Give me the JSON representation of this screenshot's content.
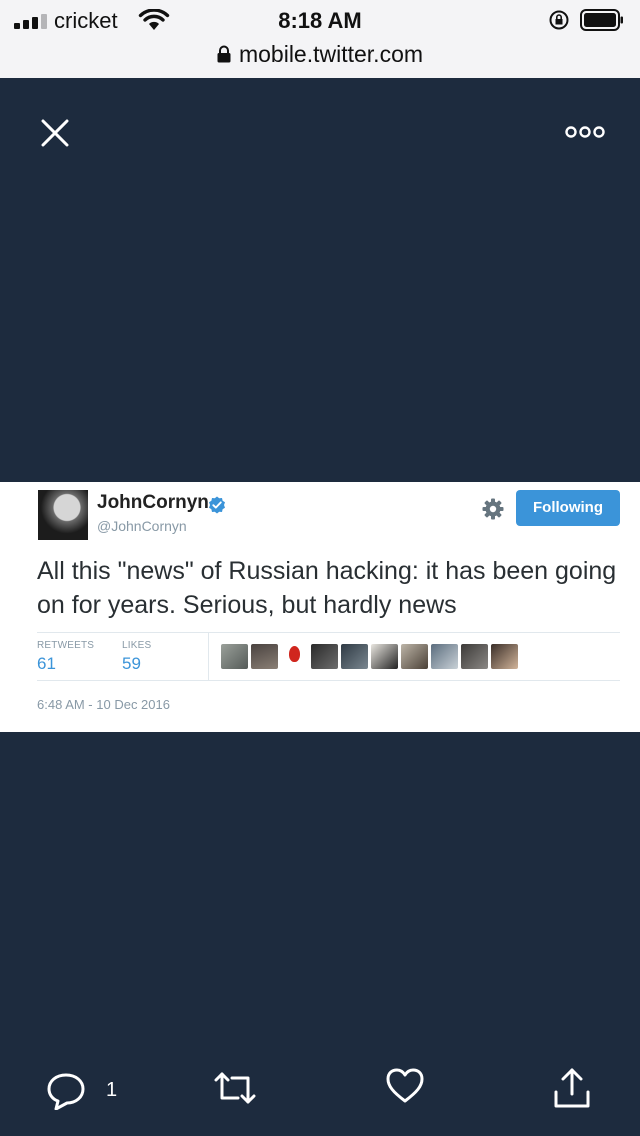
{
  "status_bar": {
    "carrier": "cricket",
    "time": "8:18 AM",
    "url": "mobile.twitter.com"
  },
  "viewer": {
    "close_icon": "close-icon",
    "more_icon": "more-options-icon"
  },
  "tweet_card": {
    "display_name": "JohnCornyn",
    "handle": "@JohnCornyn",
    "follow_label": "Following",
    "text": "All this \"news\" of Russian hacking: it has been going on for years.  Serious, but hardly news",
    "retweets_label": "RETWEETS",
    "retweets_count": "61",
    "likes_label": "LIKES",
    "likes_count": "59",
    "timestamp": "6:48 AM - 10 Dec 2016",
    "accent_color": "#3b94d9"
  },
  "actions": {
    "reply_count": "1",
    "icons": [
      "reply-icon",
      "retweet-icon",
      "like-icon",
      "share-icon"
    ]
  }
}
